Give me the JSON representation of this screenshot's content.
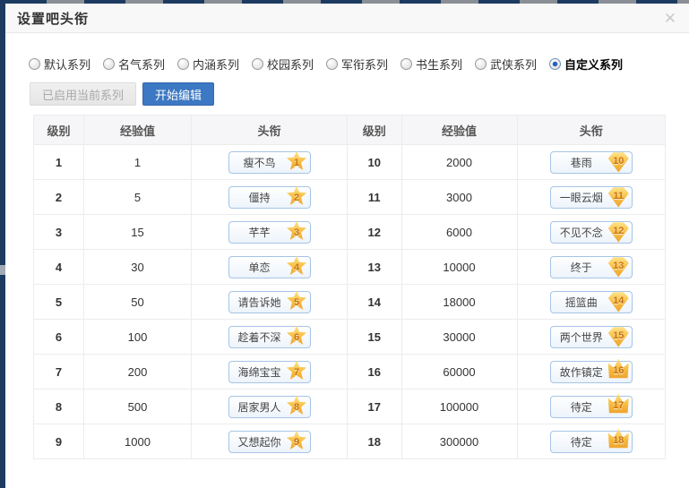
{
  "dialog": {
    "title": "设置吧头衔",
    "close_glyph": "✕"
  },
  "series_options": [
    {
      "label": "默认系列",
      "selected": false
    },
    {
      "label": "名气系列",
      "selected": false
    },
    {
      "label": "内涵系列",
      "selected": false
    },
    {
      "label": "校园系列",
      "selected": false
    },
    {
      "label": "军衔系列",
      "selected": false
    },
    {
      "label": "书生系列",
      "selected": false
    },
    {
      "label": "武侠系列",
      "selected": false
    },
    {
      "label": "自定义系列",
      "selected": true
    }
  ],
  "buttons": {
    "enabled_series": "已启用当前系列",
    "start_edit": "开始编辑"
  },
  "table": {
    "headers": [
      "级别",
      "经验值",
      "头衔"
    ],
    "left": [
      {
        "level": "1",
        "exp": "1",
        "title": "瘦不鸟",
        "badge_type": "star"
      },
      {
        "level": "2",
        "exp": "5",
        "title": "僵持",
        "badge_type": "star"
      },
      {
        "level": "3",
        "exp": "15",
        "title": "芊芊",
        "badge_type": "star"
      },
      {
        "level": "4",
        "exp": "30",
        "title": "单恋",
        "badge_type": "star"
      },
      {
        "level": "5",
        "exp": "50",
        "title": "请告诉她",
        "badge_type": "star"
      },
      {
        "level": "6",
        "exp": "100",
        "title": "趁着不深",
        "badge_type": "star"
      },
      {
        "level": "7",
        "exp": "200",
        "title": "海绵宝宝",
        "badge_type": "star"
      },
      {
        "level": "8",
        "exp": "500",
        "title": "居家男人",
        "badge_type": "star"
      },
      {
        "level": "9",
        "exp": "1000",
        "title": "又想起你",
        "badge_type": "star"
      }
    ],
    "right": [
      {
        "level": "10",
        "exp": "2000",
        "title": "巷雨",
        "badge_type": "gem"
      },
      {
        "level": "11",
        "exp": "3000",
        "title": "一眼云烟",
        "badge_type": "gem"
      },
      {
        "level": "12",
        "exp": "6000",
        "title": "不见不念",
        "badge_type": "gem"
      },
      {
        "level": "13",
        "exp": "10000",
        "title": "终于",
        "badge_type": "gem"
      },
      {
        "level": "14",
        "exp": "18000",
        "title": "摇篮曲",
        "badge_type": "gem"
      },
      {
        "level": "15",
        "exp": "30000",
        "title": "两个世界",
        "badge_type": "gem"
      },
      {
        "level": "16",
        "exp": "60000",
        "title": "故作镇定",
        "badge_type": "crown"
      },
      {
        "level": "17",
        "exp": "100000",
        "title": "待定",
        "badge_type": "crown"
      },
      {
        "level": "18",
        "exp": "300000",
        "title": "待定",
        "badge_type": "crown"
      }
    ]
  },
  "colors": {
    "accent": "#3c78c3",
    "navy": "#1d3b61",
    "badge_gold": "#f7bb3e",
    "chip_border": "#a6c4e6"
  }
}
